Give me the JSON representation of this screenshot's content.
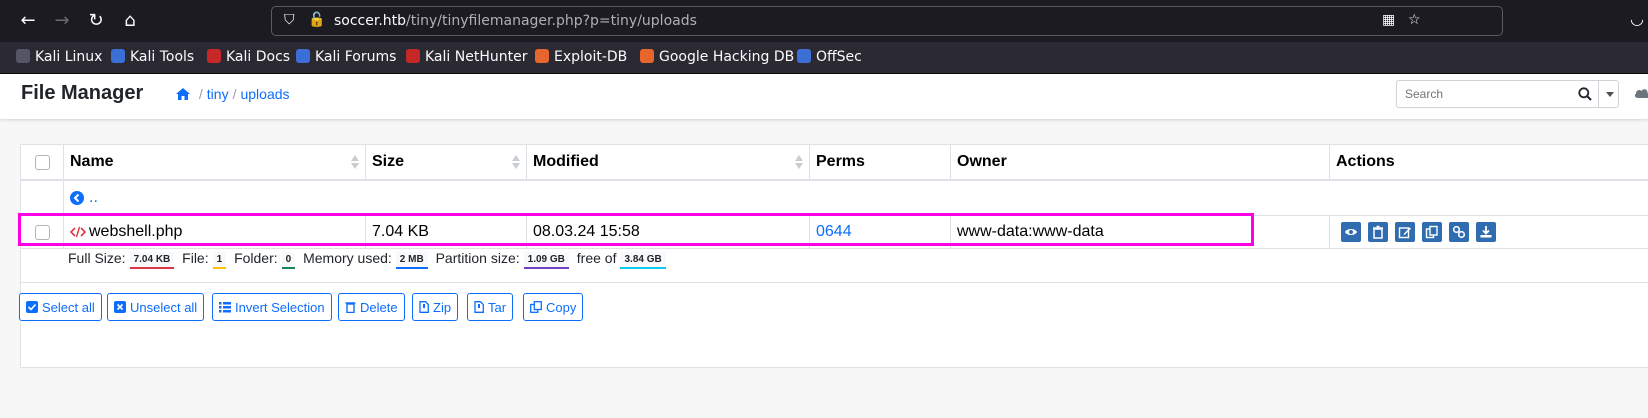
{
  "browser": {
    "url_host": "soccer.htb",
    "url_path": "/tiny/tinyfilemanager.php?p=tiny/uploads",
    "bookmarks": [
      "Kali Linux",
      "Kali Tools",
      "Kali Docs",
      "Kali Forums",
      "Kali NetHunter",
      "Exploit-DB",
      "Google Hacking DB",
      "OffSec"
    ]
  },
  "header": {
    "brand": "File Manager",
    "breadcrumb": [
      "tiny",
      "uploads"
    ],
    "breadcrumb_sep": "/",
    "search_placeholder": "Search"
  },
  "table": {
    "columns": [
      "Name",
      "Size",
      "Modified",
      "Perms",
      "Owner",
      "Actions"
    ],
    "parent_link": "..",
    "rows": [
      {
        "name": "webshell.php",
        "size": "7.04 KB",
        "modified": "08.03.24 15:58",
        "perms": "0644",
        "owner": "www-data:www-data"
      }
    ]
  },
  "summary": {
    "full_size_label": "Full Size:",
    "full_size": "7.04 KB",
    "file_label": "File:",
    "file": "1",
    "folder_label": "Folder:",
    "folder": "0",
    "memory_label": "Memory used:",
    "memory": "2 MB",
    "partition_label": "Partition size:",
    "partition": "1.09 GB",
    "free_label": "free of",
    "free": "3.84 GB"
  },
  "buttons": {
    "select_all": "Select all",
    "unselect_all": "Unselect all",
    "invert": "Invert Selection",
    "delete": "Delete",
    "zip": "Zip",
    "tar": "Tar",
    "copy": "Copy"
  },
  "colors": {
    "highlight": "#ff00e6",
    "link": "#0d6efd",
    "action_button": "#2f6db0"
  }
}
